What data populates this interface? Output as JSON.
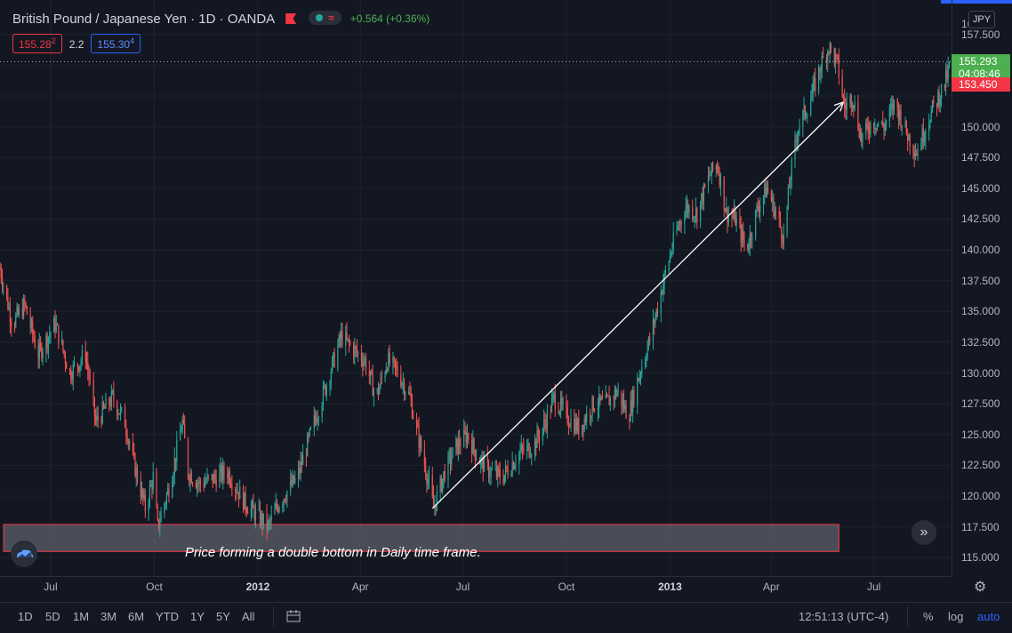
{
  "header": {
    "symbol": "British Pound / Japanese Yen · 1D · OANDA",
    "change": "+0.564 (+0.36%)",
    "wave_icon": "≈",
    "bid": "155.28",
    "bid_sup": "2",
    "spread": "2.2",
    "ask": "155.30",
    "ask_sup": "4"
  },
  "currency_button": "JPY",
  "price_tags": {
    "last": "155.293",
    "countdown": "04:08:46",
    "line": "153.450",
    "top_partial": "16"
  },
  "annotation": "Price forming a double bottom in Daily time frame.",
  "ranges": [
    "1D",
    "5D",
    "1M",
    "3M",
    "6M",
    "YTD",
    "1Y",
    "5Y",
    "All"
  ],
  "clock": "12:51:13 (UTC-4)",
  "scale_options": [
    "%",
    "log",
    "auto"
  ],
  "colors": {
    "up": "#26a69a",
    "down": "#ef5350",
    "background": "#131722",
    "accent": "#2962ff"
  },
  "chart_data": {
    "type": "candlestick",
    "symbol": "GBPJPY",
    "interval": "1D",
    "y_ticks": [
      115,
      117.5,
      120,
      122.5,
      125,
      127.5,
      130,
      132.5,
      135,
      137.5,
      140,
      142.5,
      145,
      147.5,
      150,
      152.5,
      155,
      157.5
    ],
    "y_tick_labels": [
      "115.000",
      "117.500",
      "120.000",
      "122.500",
      "125.000",
      "127.500",
      "130.000",
      "132.500",
      "135.000",
      "137.500",
      "140.000",
      "142.500",
      "145.000",
      "147.500",
      "150.000",
      "",
      "",
      "157.500"
    ],
    "ylim": [
      113.5,
      160.3
    ],
    "x_tick_labels": [
      "Jul",
      "Oct",
      "2012",
      "Apr",
      "Jul",
      "Oct",
      "2013",
      "Apr",
      "Jul"
    ],
    "x_tick_bold": [
      false,
      false,
      true,
      false,
      false,
      false,
      true,
      false,
      false
    ],
    "x_tick_dates": [
      "2011-07-01",
      "2011-10-01",
      "2012-01-01",
      "2012-04-01",
      "2012-07-01",
      "2012-10-01",
      "2013-01-01",
      "2013-04-01",
      "2013-07-01"
    ],
    "xlim": [
      "2011-05-17",
      "2013-09-08"
    ],
    "price_path": [
      [
        "2011-05-17",
        138.5
      ],
      [
        "2011-05-28",
        134.0
      ],
      [
        "2011-06-08",
        135.5
      ],
      [
        "2011-06-20",
        131.5
      ],
      [
        "2011-07-05",
        134.0
      ],
      [
        "2011-07-18",
        130.0
      ],
      [
        "2011-08-01",
        131.5
      ],
      [
        "2011-08-10",
        126.0
      ],
      [
        "2011-08-25",
        128.0
      ],
      [
        "2011-09-05",
        126.0
      ],
      [
        "2011-09-12",
        123.0
      ],
      [
        "2011-09-23",
        119.0
      ],
      [
        "2011-09-30",
        121.5
      ],
      [
        "2011-10-04",
        117.5
      ],
      [
        "2011-10-15",
        121.0
      ],
      [
        "2011-10-26",
        126.0
      ],
      [
        "2011-10-31",
        122.0
      ],
      [
        "2011-11-10",
        121.0
      ],
      [
        "2011-11-25",
        121.5
      ],
      [
        "2011-12-05",
        122.0
      ],
      [
        "2011-12-20",
        119.5
      ],
      [
        "2012-01-10",
        117.5
      ],
      [
        "2012-01-20",
        119.5
      ],
      [
        "2012-02-05",
        121.5
      ],
      [
        "2012-02-20",
        126.0
      ],
      [
        "2012-03-05",
        130.0
      ],
      [
        "2012-03-15",
        133.0
      ],
      [
        "2012-03-25",
        132.0
      ],
      [
        "2012-04-05",
        131.0
      ],
      [
        "2012-04-15",
        128.0
      ],
      [
        "2012-04-25",
        131.0
      ],
      [
        "2012-05-05",
        130.0
      ],
      [
        "2012-05-15",
        128.0
      ],
      [
        "2012-05-22",
        125.0
      ],
      [
        "2012-06-01",
        121.0
      ],
      [
        "2012-06-05",
        119.0
      ],
      [
        "2012-06-15",
        122.0
      ],
      [
        "2012-06-25",
        124.0
      ],
      [
        "2012-07-05",
        125.0
      ],
      [
        "2012-07-15",
        123.0
      ],
      [
        "2012-07-25",
        122.0
      ],
      [
        "2012-08-05",
        121.5
      ],
      [
        "2012-08-20",
        123.5
      ],
      [
        "2012-09-01",
        124.0
      ],
      [
        "2012-09-10",
        125.5
      ],
      [
        "2012-09-20",
        128.0
      ],
      [
        "2012-10-01",
        126.5
      ],
      [
        "2012-10-12",
        125.5
      ],
      [
        "2012-10-25",
        127.5
      ],
      [
        "2012-11-05",
        127.5
      ],
      [
        "2012-11-15",
        128.5
      ],
      [
        "2012-11-25",
        126.5
      ],
      [
        "2012-12-05",
        130.0
      ],
      [
        "2012-12-15",
        133.0
      ],
      [
        "2012-12-25",
        137.0
      ],
      [
        "2013-01-05",
        141.0
      ],
      [
        "2013-01-15",
        143.5
      ],
      [
        "2013-01-25",
        143.0
      ],
      [
        "2013-02-05",
        146.0
      ],
      [
        "2013-02-12",
        147.0
      ],
      [
        "2013-02-20",
        143.0
      ],
      [
        "2013-02-28",
        142.5
      ],
      [
        "2013-03-10",
        140.0
      ],
      [
        "2013-03-20",
        143.5
      ],
      [
        "2013-03-28",
        145.0
      ],
      [
        "2013-04-05",
        143.0
      ],
      [
        "2013-04-12",
        141.0
      ],
      [
        "2013-04-18",
        146.0
      ],
      [
        "2013-04-25",
        150.0
      ],
      [
        "2013-05-05",
        152.0
      ],
      [
        "2013-05-15",
        155.0
      ],
      [
        "2013-05-22",
        156.5
      ],
      [
        "2013-05-30",
        155.0
      ],
      [
        "2013-06-05",
        151.5
      ],
      [
        "2013-06-12",
        152.5
      ],
      [
        "2013-06-20",
        149.0
      ],
      [
        "2013-06-30",
        150.5
      ],
      [
        "2013-07-10",
        150.0
      ],
      [
        "2013-07-20",
        152.0
      ],
      [
        "2013-07-30",
        149.5
      ],
      [
        "2013-08-08",
        148.0
      ],
      [
        "2013-08-20",
        151.0
      ],
      [
        "2013-09-02",
        153.5
      ],
      [
        "2013-09-08",
        155.3
      ]
    ],
    "trendline": {
      "from": [
        "2012-06-04",
        119.0
      ],
      "to": [
        "2013-06-04",
        152.0
      ],
      "arrow": true
    },
    "support_zone": {
      "from": "2011-05-17",
      "to": "2013-05-31",
      "y_low": 115.5,
      "y_high": 117.7
    },
    "last_price": 155.293,
    "line_price": 153.45,
    "grid": true,
    "legend": "top-left"
  }
}
